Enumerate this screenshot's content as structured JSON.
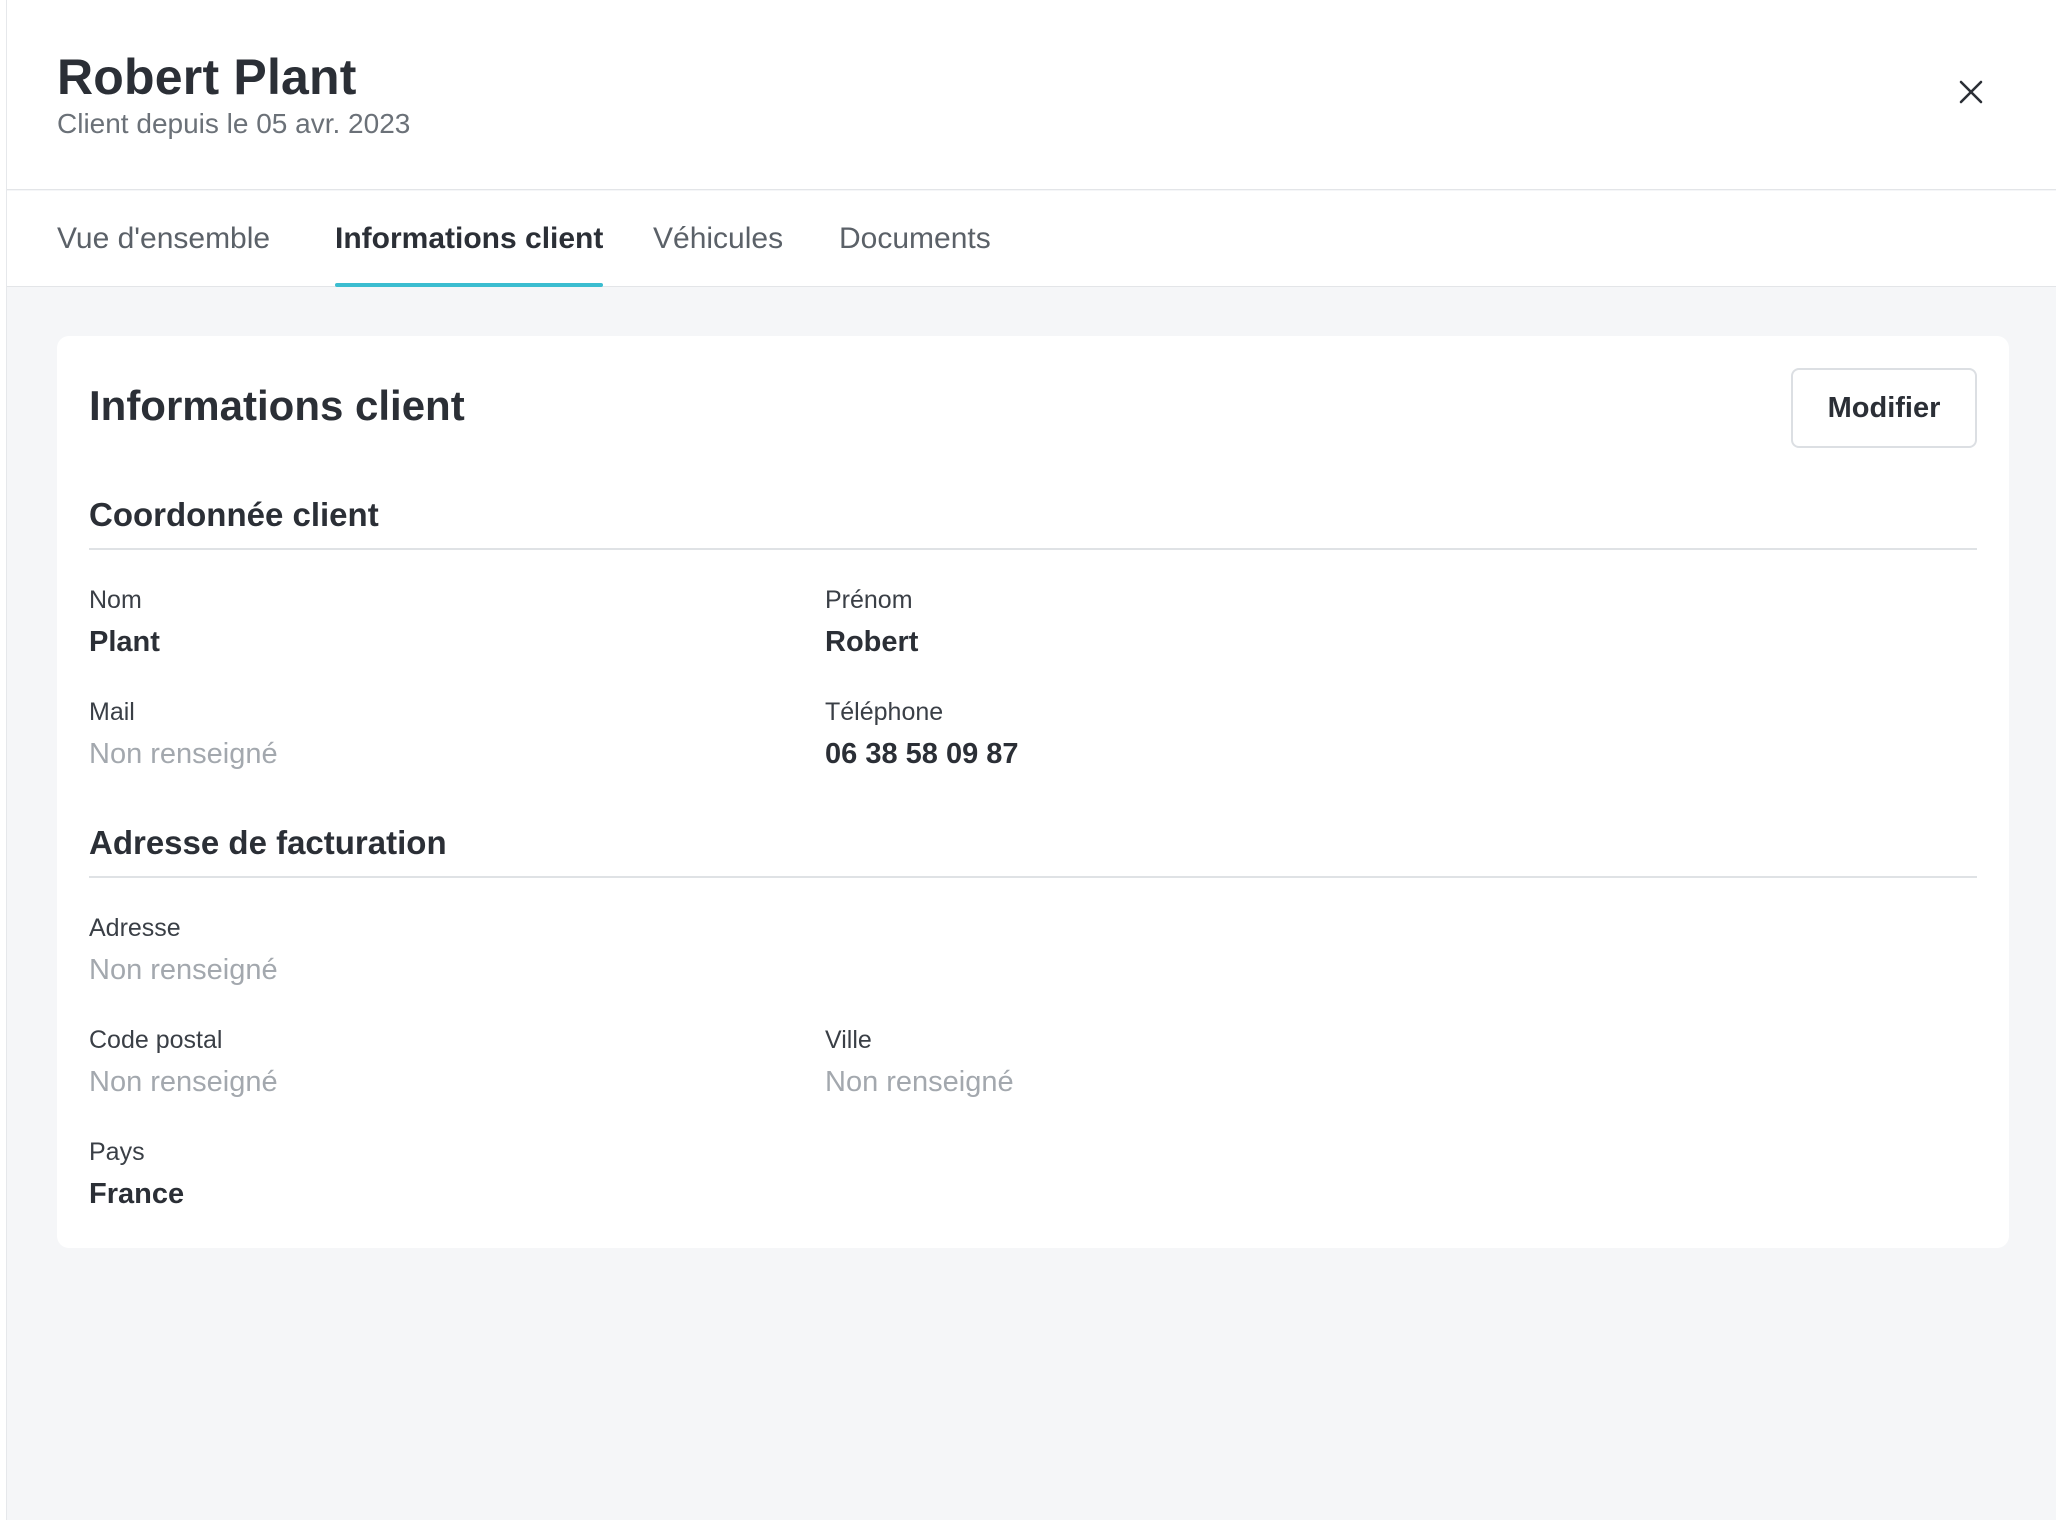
{
  "header": {
    "title": "Robert Plant",
    "subtitle": "Client depuis le 05 avr. 2023",
    "close_icon": "close-icon"
  },
  "tabs": [
    {
      "label": "Vue d'ensemble",
      "active": false
    },
    {
      "label": "Informations client",
      "active": true
    },
    {
      "label": "Véhicules",
      "active": false
    },
    {
      "label": "Documents",
      "active": false
    }
  ],
  "card": {
    "title": "Informations client",
    "edit_label": "Modifier",
    "contact_section": {
      "title": "Coordonnée client",
      "fields": {
        "nom": {
          "label": "Nom",
          "value": "Plant"
        },
        "prenom": {
          "label": "Prénom",
          "value": "Robert"
        },
        "mail": {
          "label": "Mail",
          "value": "Non renseigné"
        },
        "telephone": {
          "label": "Téléphone",
          "value": "06 38 58 09 87"
        }
      }
    },
    "billing_section": {
      "title": "Adresse de facturation",
      "fields": {
        "adresse": {
          "label": "Adresse",
          "value": "Non renseigné"
        },
        "code_postal": {
          "label": "Code postal",
          "value": "Non renseigné"
        },
        "ville": {
          "label": "Ville",
          "value": "Non renseigné"
        },
        "pays": {
          "label": "Pays",
          "value": "France"
        }
      }
    }
  },
  "colors": {
    "accent": "#3bbdd0",
    "placeholder_text": "#a3a8ae",
    "background": "#f5f6f8"
  }
}
